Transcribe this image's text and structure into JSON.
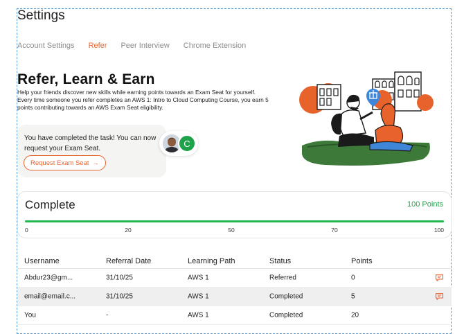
{
  "page": {
    "title": "Settings"
  },
  "tabs": [
    {
      "label": "Account Settings",
      "active": false
    },
    {
      "label": "Refer",
      "active": true
    },
    {
      "label": "Peer Interview",
      "active": false
    },
    {
      "label": "Chrome Extension",
      "active": false
    }
  ],
  "hero": {
    "title": "Refer, Learn & Earn",
    "description": "Help your friends discover new skills while earning points towards an Exam Seat for yourself. Every time someone you refer completes an AWS 1: Intro to Cloud Computing Course, you earn 5 points contributing towards an AWS Exam Seat eligibility."
  },
  "task": {
    "message": "You have completed the task! You can now request your Exam Seat.",
    "button_label": "Request Exam Seat",
    "button_arrow": "→",
    "avatar_letter": "C"
  },
  "progress": {
    "status": "Complete",
    "points_label": "100 Points",
    "value": 100,
    "max": 100,
    "ticks": [
      "0",
      "20",
      "50",
      "70",
      "100"
    ]
  },
  "table": {
    "headers": [
      "Username",
      "Referral Date",
      "Learning Path",
      "Status",
      "Points"
    ],
    "rows": [
      {
        "username": "Abdur23@gm...",
        "date": "31/10/25",
        "path": "AWS 1",
        "status": "Referred",
        "points": "0",
        "chat": true
      },
      {
        "username": "email@email.c...",
        "date": "31/10/25",
        "path": "AWS 1",
        "status": "Completed",
        "points": "5",
        "chat": true
      },
      {
        "username": "You",
        "date": "-",
        "path": "AWS 1",
        "status": "Completed",
        "points": "20",
        "chat": false
      }
    ]
  },
  "colors": {
    "accent": "#e8632b",
    "success": "#1fa34a",
    "muted": "#8a8a8a",
    "illustration_blue": "#3f86d9"
  }
}
